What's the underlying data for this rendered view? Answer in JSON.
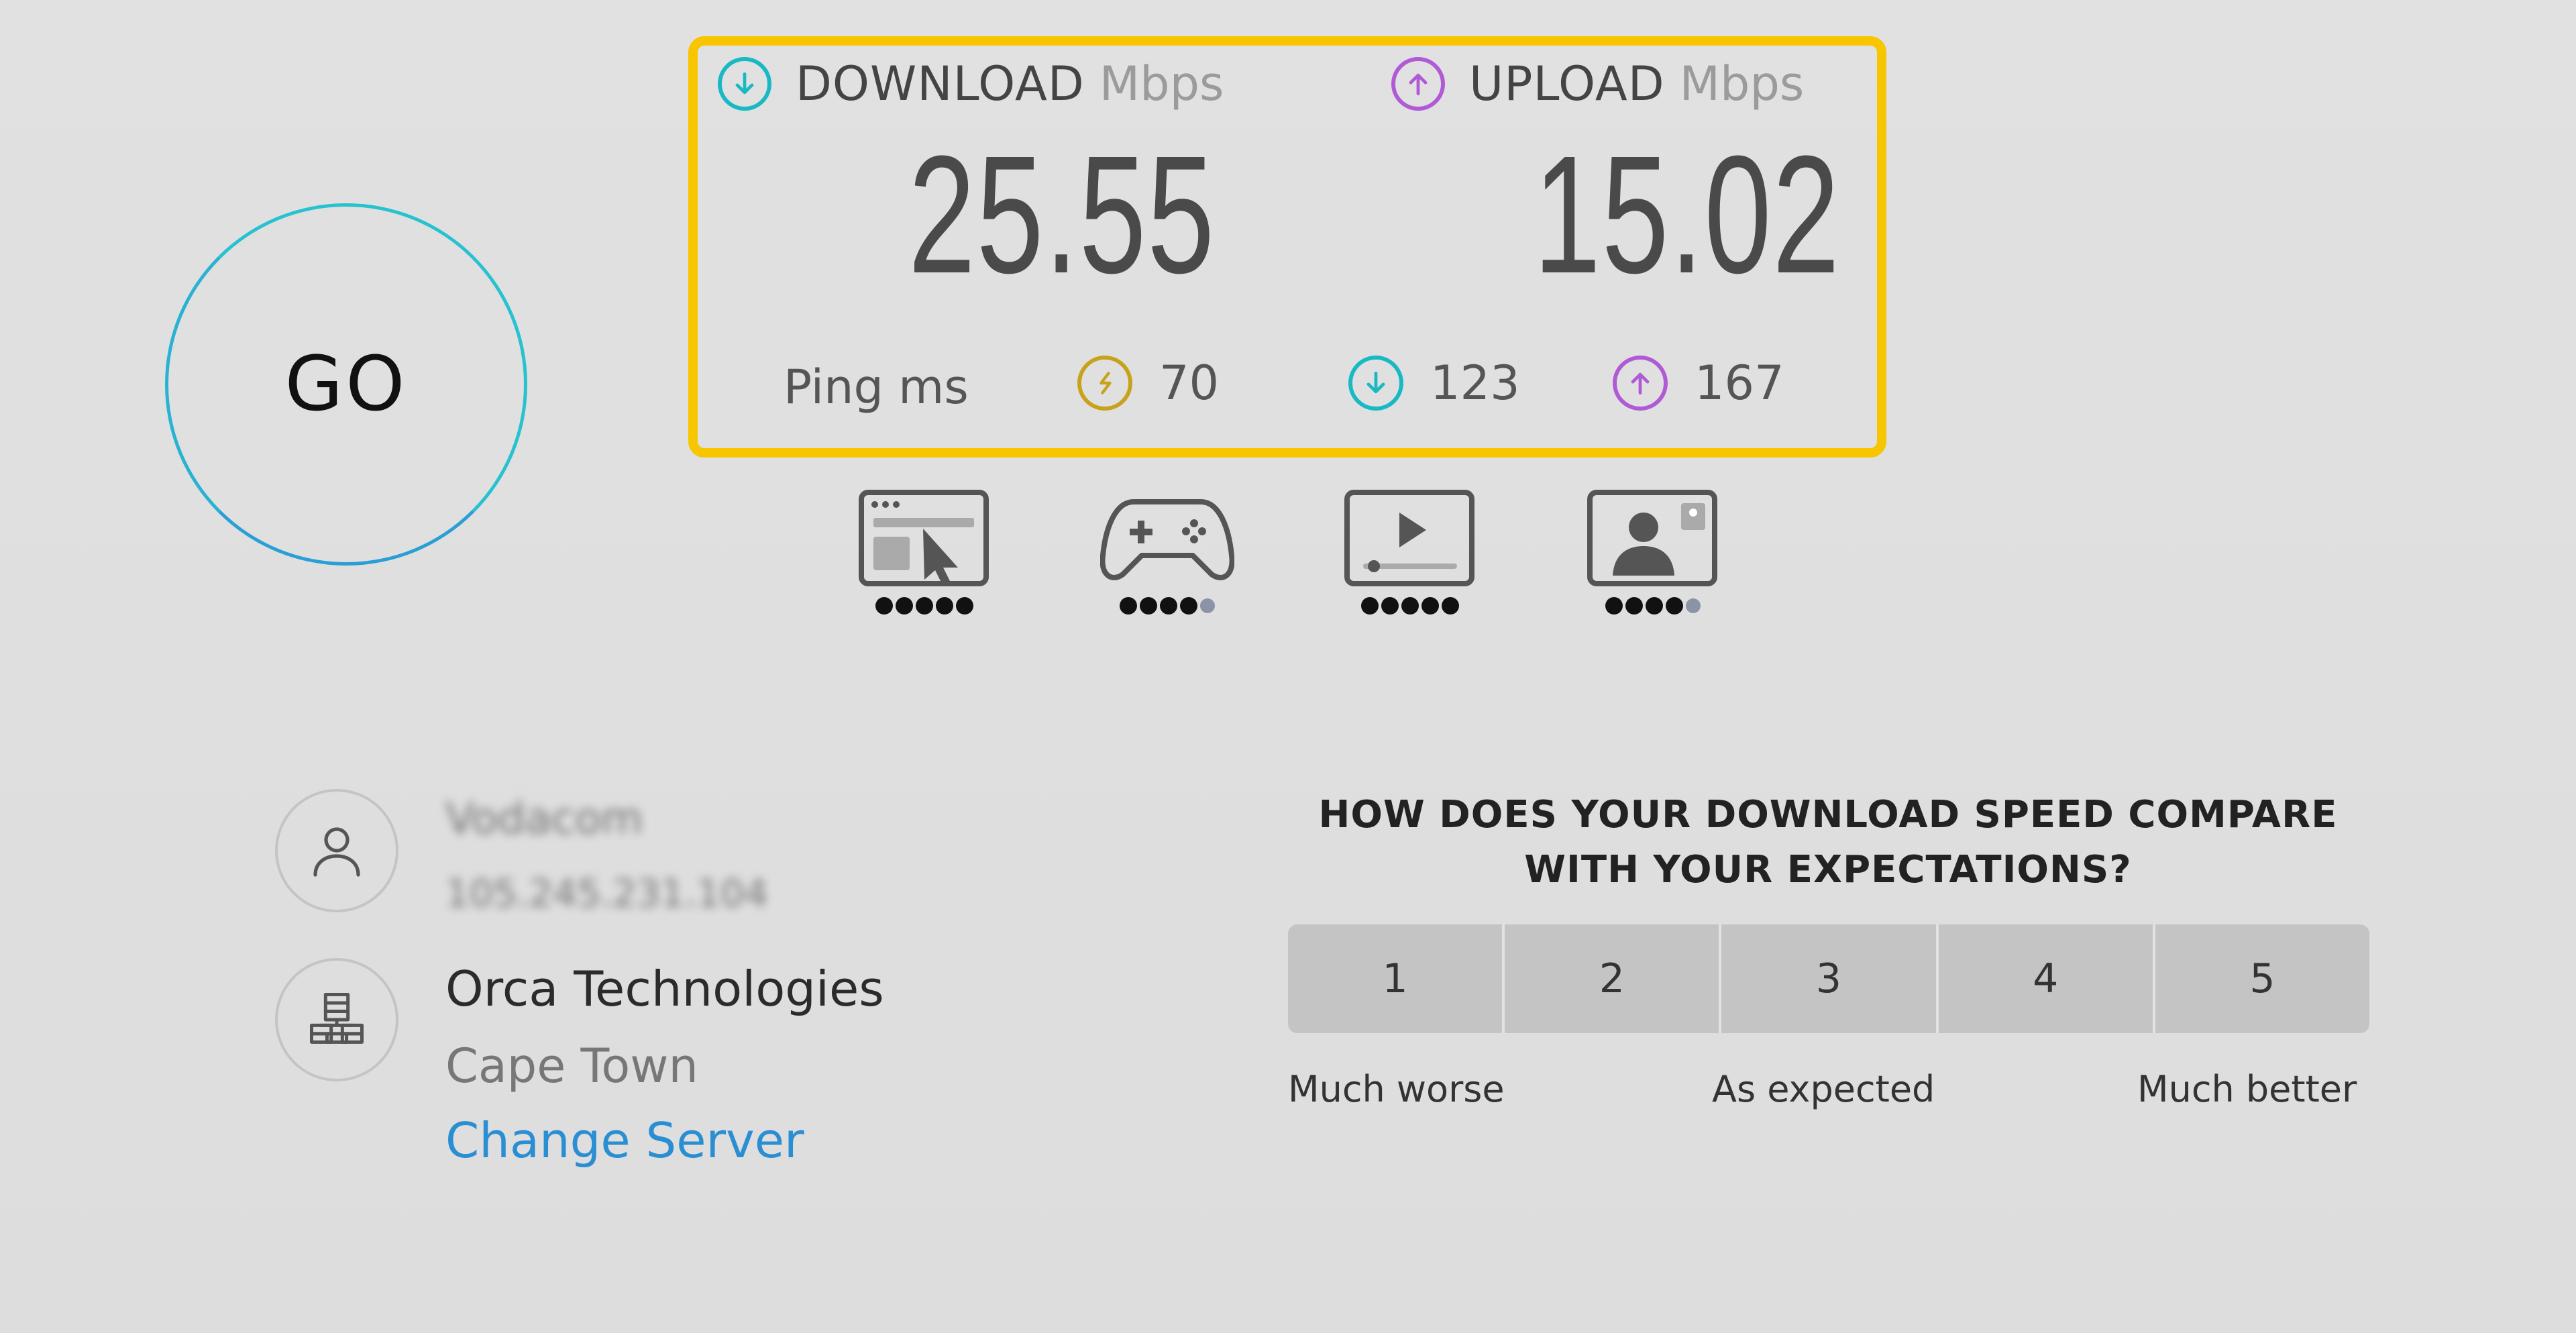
{
  "go_button": {
    "label": "GO"
  },
  "results": {
    "download": {
      "title": "DOWNLOAD",
      "unit": "Mbps",
      "value": "25.55",
      "color": "#19b9c4"
    },
    "upload": {
      "title": "UPLOAD",
      "unit": "Mbps",
      "value": "15.02",
      "color": "#b05ad6"
    },
    "ping": {
      "label": "Ping ms",
      "idle": {
        "icon": "ping-idle-icon",
        "value": "70",
        "color": "#c8a21c"
      },
      "download": {
        "icon": "ping-download-icon",
        "value": "123",
        "color": "#19b9c4"
      },
      "upload": {
        "icon": "ping-upload-icon",
        "value": "167",
        "color": "#b05ad6"
      }
    },
    "highlight_color": "#f7c600"
  },
  "usage_ratings": [
    {
      "icon": "web-browsing-icon",
      "rating": 5,
      "max": 5
    },
    {
      "icon": "gaming-controller-icon",
      "rating": 4,
      "max": 5
    },
    {
      "icon": "video-streaming-icon",
      "rating": 5,
      "max": 5
    },
    {
      "icon": "video-call-icon",
      "rating": 4,
      "max": 5
    }
  ],
  "provider": {
    "name": "Vodacom",
    "ip": "105.245.231.104",
    "icon": "user-icon"
  },
  "server": {
    "name": "Orca Technologies",
    "city": "Cape Town",
    "change_label": "Change Server",
    "icon": "server-icon",
    "link_color": "#2a8fd2"
  },
  "survey": {
    "question": "HOW DOES YOUR DOWNLOAD SPEED COMPARE WITH YOUR EXPECTATIONS?",
    "options": [
      "1",
      "2",
      "3",
      "4",
      "5"
    ],
    "scale_low": "Much worse",
    "scale_mid": "As expected",
    "scale_high": "Much better"
  }
}
